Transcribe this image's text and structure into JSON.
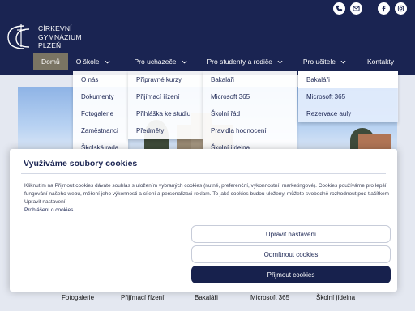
{
  "school": {
    "name_lines": [
      "CÍRKEVNÍ",
      "GYMNÁZIUM",
      "PLZEŇ"
    ],
    "logo_icon": "school-logo-icon"
  },
  "social": {
    "icons": [
      "phone-icon",
      "mail-icon",
      "facebook-icon",
      "instagram-icon"
    ]
  },
  "nav": {
    "home": "Domů",
    "o_skole": "O škole",
    "pro_uchazece": "Pro uchazeče",
    "pro_studenty": "Pro studenty a rodiče",
    "pro_ucitele": "Pro učitele",
    "kontakty": "Kontakty"
  },
  "dropdowns": {
    "o_skole": [
      "O nás",
      "Dokumenty",
      "Fotogalerie",
      "Zaměstnanci",
      "Školská rada"
    ],
    "pro_uchazece": [
      "Přípravné kurzy",
      "Přijímací řízení",
      "Přihláška ke studiu",
      "Předměty"
    ],
    "pro_studenty": [
      "Bakaláři",
      "Microsoft 365",
      "Školní řád",
      "Pravidla hodnocení",
      "Školní jídelna"
    ],
    "pro_ucitele": [
      "Bakaláři",
      "Microsoft 365",
      "Rezervace auly"
    ]
  },
  "cookie": {
    "title": "Využíváme soubory cookies",
    "text": "Kliknutím na Přijmout cookies dáváte souhlas s uložením vybraných cookies (nutné, preferenční, výkonnostní, marketingové). Cookies používáme pro lepší fungování našeho webu, měření jeho výkonnosti a cílení a personalizaci reklam. To jaké cookies budou uloženy, můžete svobodně rozhodnout pod tlačítkem Upravit nastavení.",
    "link": "Prohlášení o cookies.",
    "btn_settings": "Upravit nastavení",
    "btn_reject": "Odmítnout cookies",
    "btn_accept": "Přijmout cookies"
  },
  "quick_links": [
    "Fotogalerie",
    "Přijímací řízení",
    "Bakaláři",
    "Microsoft 365",
    "Školní jídelna"
  ],
  "colors": {
    "navy": "#1a2452",
    "home_bg": "#7a7463",
    "accept_bg": "#17214d"
  }
}
